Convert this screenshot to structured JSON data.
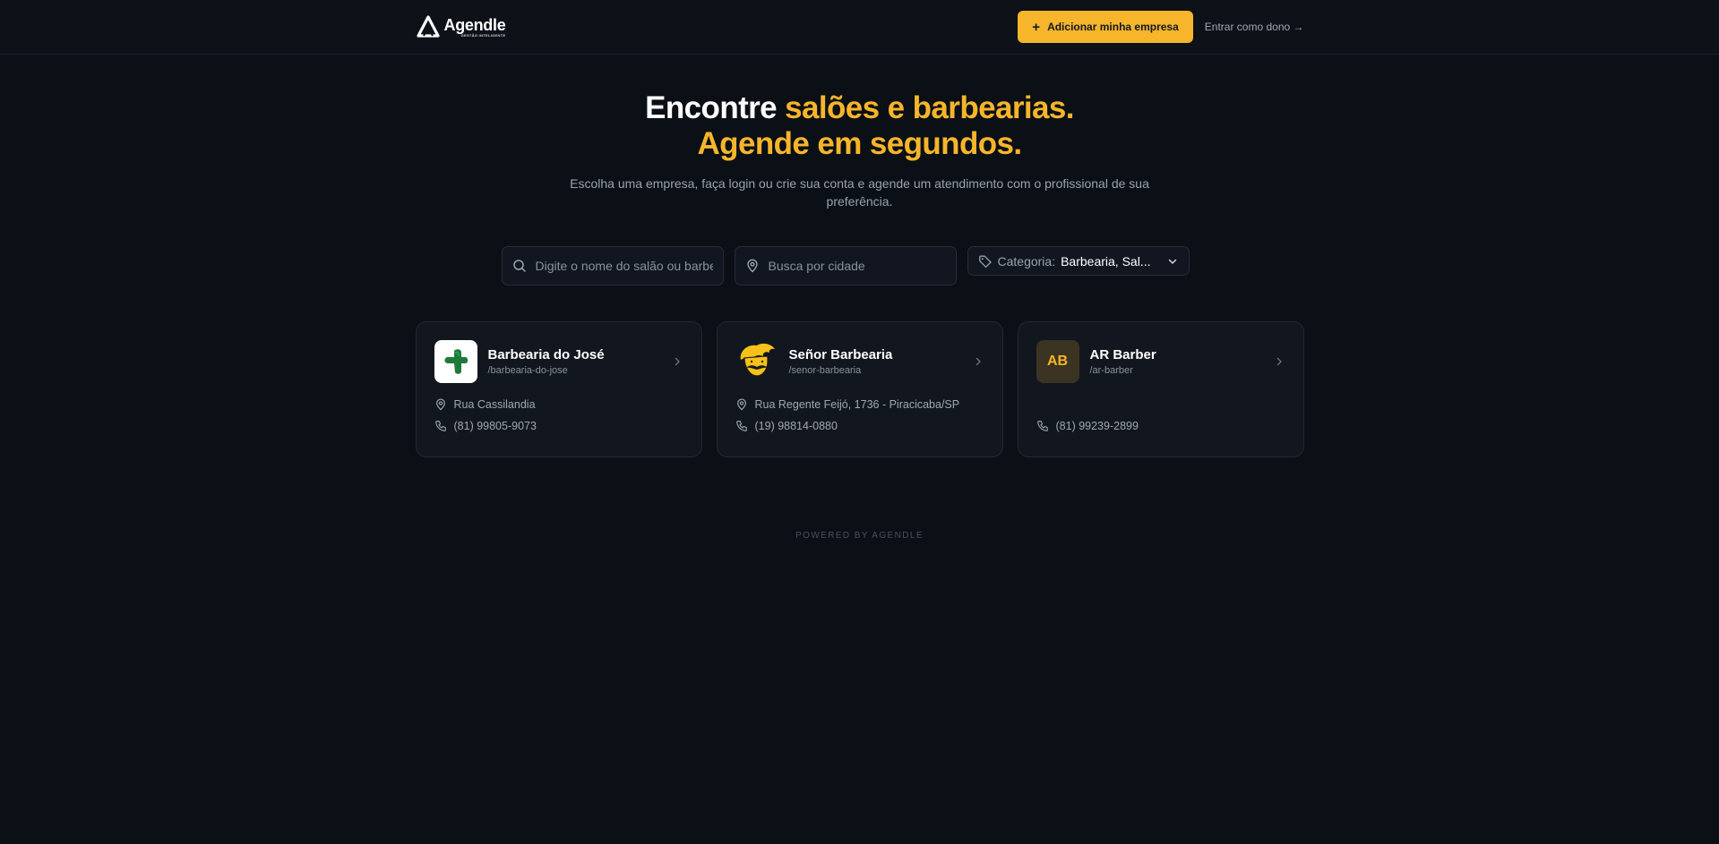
{
  "header": {
    "logo_name": "Agendle",
    "logo_sub": "GESTÃO INTELIGENTE",
    "add_button": "Adicionar minha empresa",
    "owner_link": "Entrar como dono →"
  },
  "hero": {
    "title_white": "Encontre ",
    "title_gold_1": "salões e barbearias.",
    "title_gold_2": "Agende em segundos.",
    "subtitle": "Escolha uma empresa, faça login ou crie sua conta e agende um atendimento com o profissional de sua preferência."
  },
  "filters": {
    "search_placeholder": "Digite o nome do salão ou barbearia",
    "city_placeholder": "Busca por cidade",
    "category_label": "Categoria:",
    "category_value": "Barbearia, Sal..."
  },
  "businesses": [
    {
      "name": "Barbearia do José",
      "slug": "/barbearia-do-jose",
      "address": "Rua Cassilandia",
      "phone": "(81) 99805-9073"
    },
    {
      "name": "Señor Barbearia",
      "slug": "/senor-barbearia",
      "address": "Rua Regente Feijó, 1736 - Piracicaba/SP",
      "phone": "(19) 98814-0880"
    },
    {
      "name": "AR Barber",
      "slug": "/ar-barber",
      "initials": "AB",
      "address": "",
      "phone": "(81) 99239-2899"
    }
  ],
  "footer": {
    "text": "POWERED BY AGENDLE"
  },
  "colors": {
    "accent": "#f6b52a",
    "background": "#0b0f16",
    "card": "#12171f"
  }
}
